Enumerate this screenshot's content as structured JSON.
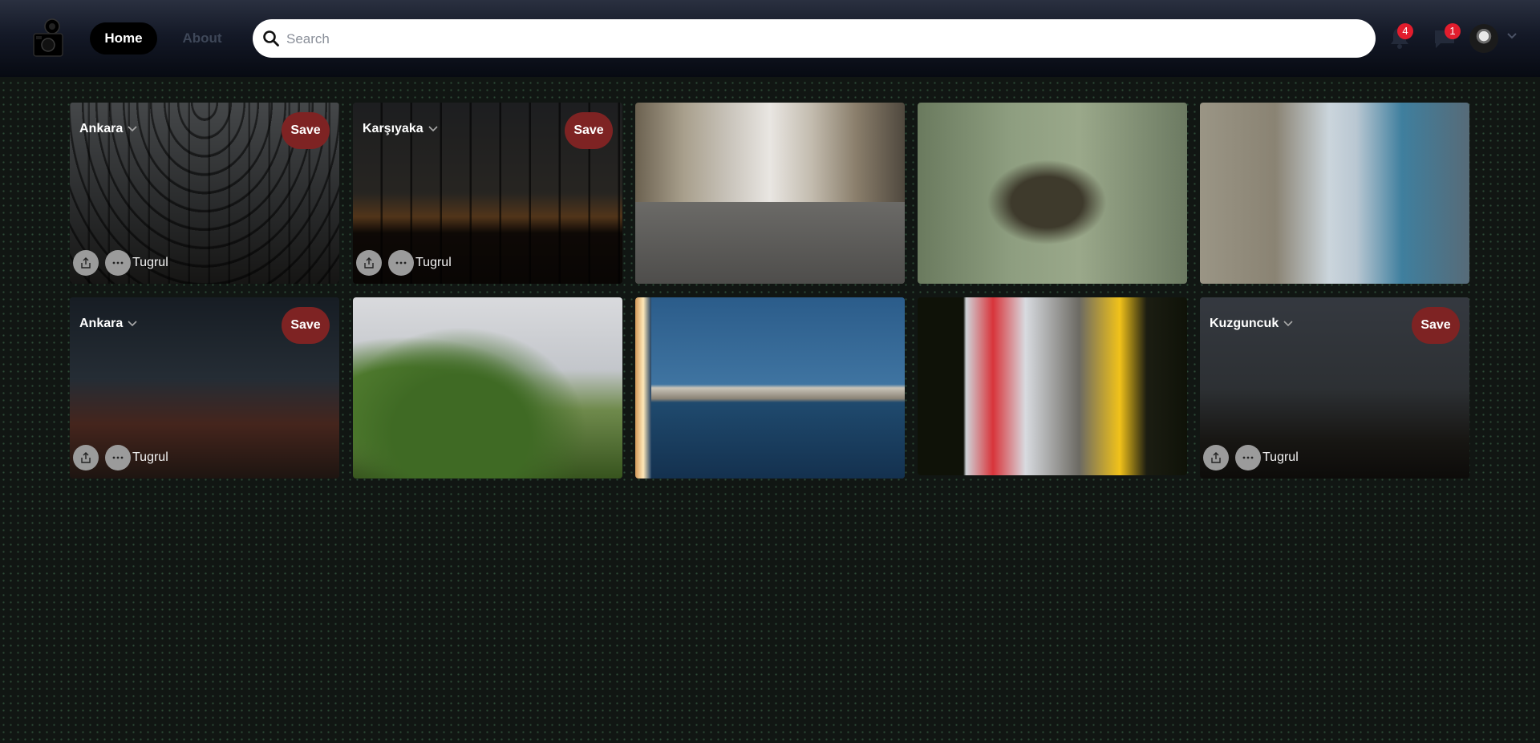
{
  "header": {
    "nav": {
      "home_label": "Home",
      "about_label": "About"
    },
    "search": {
      "placeholder": "Search",
      "icon": "search-icon"
    },
    "notifications": {
      "icon": "bell-icon",
      "count": "4"
    },
    "messages": {
      "icon": "chat-icon",
      "count": "1"
    },
    "profile": {
      "icon": "avatar",
      "menu_icon": "chevron-down-icon"
    },
    "colors": {
      "badge": "#e21d2d",
      "active_nav_bg": "#000000"
    }
  },
  "pins": [
    {
      "board": "Ankara",
      "save_label": "Save",
      "author": "Tugrul",
      "hovered": true
    },
    {
      "board": "Karşıyaka",
      "save_label": "Save",
      "author": "Tugrul",
      "hovered": true
    },
    {
      "hovered": false
    },
    {
      "hovered": false
    },
    {
      "hovered": false
    },
    {
      "board": "Ankara",
      "save_label": "Save",
      "author": "Tugrul",
      "hovered": true
    },
    {
      "hovered": false
    },
    {
      "hovered": false
    },
    {
      "hovered": false
    },
    {
      "board": "Kuzguncuk",
      "save_label": "Save",
      "author": "Tugrul",
      "hovered": true
    }
  ],
  "colors": {
    "save_button": "#7e2323",
    "page_background": "#111613"
  }
}
